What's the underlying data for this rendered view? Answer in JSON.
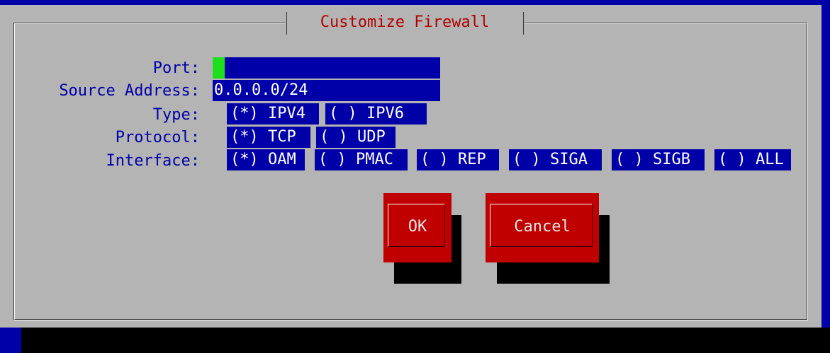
{
  "title": "Customize Firewall",
  "fields": {
    "port": {
      "label": "Port:",
      "value": ""
    },
    "source_address": {
      "label": "Source Address:",
      "value": "0.0.0.0/24"
    }
  },
  "type": {
    "label": "Type:",
    "options": [
      "(*) IPV4",
      "( ) IPV6"
    ]
  },
  "protocol": {
    "label": "Protocol:",
    "options": [
      "(*) TCP",
      "( ) UDP"
    ]
  },
  "interface": {
    "label": "Interface:",
    "options": [
      "(*) OAM",
      "( ) PMAC",
      "( ) REP",
      "( ) SIGA",
      "( ) SIGB",
      "( ) ALL"
    ]
  },
  "buttons": {
    "ok": "OK",
    "cancel": "Cancel"
  },
  "colors": {
    "screen_background": "#0000a8",
    "dialog_background": "#b4b4b4",
    "title_text": "#b20000",
    "button": "#c00000",
    "cursor": "#1ce01c"
  }
}
